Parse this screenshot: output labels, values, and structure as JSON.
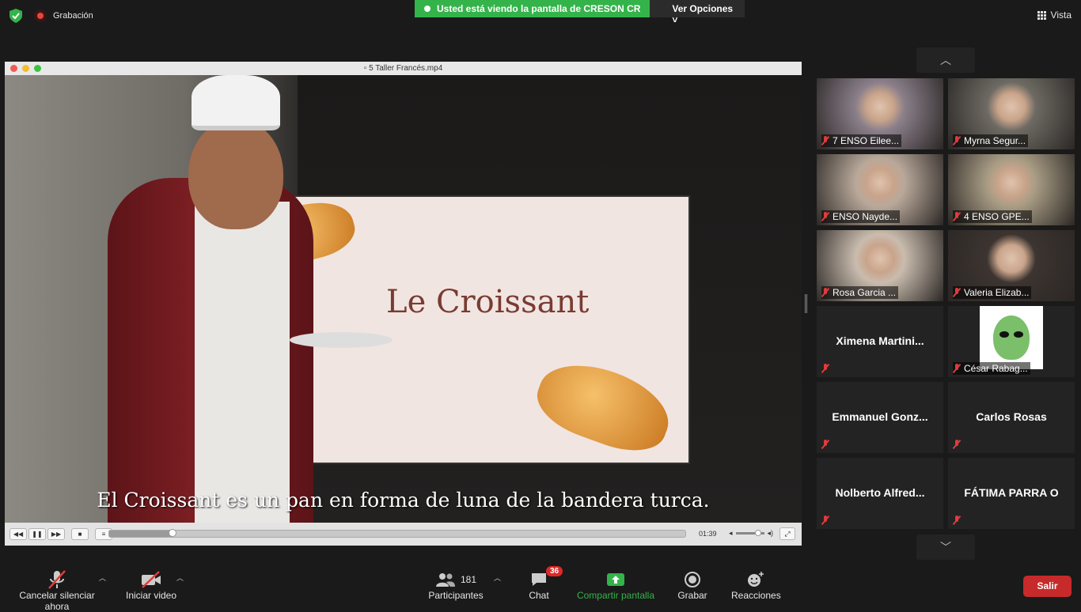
{
  "topbar": {
    "recording_label": "Grabación",
    "viewing_banner": "Usted está viendo la pantalla de CRESON CR",
    "view_options": "Ver Opciones",
    "view_button": "Vista",
    "shield_color": "#34b34a"
  },
  "player": {
    "filename": "5 Taller Francés.mp4",
    "screen_title": "Le Croissant",
    "subtitle": "El Croissant es un pan en forma de luna de la bandera turca.",
    "time": "01:39",
    "progress_fraction": 0.11,
    "buttons": {
      "rewind": "◀◀",
      "pause": "❚❚",
      "forward": "▶▶",
      "stop": "■",
      "playlist": "≡",
      "fullscreen": "⤢"
    },
    "volume_icon": "speaker-icon"
  },
  "participants": [
    {
      "name": "7 ENSO Eilee...",
      "video": true,
      "color": "#8a7f8a"
    },
    {
      "name": "Myrna Segur...",
      "video": true,
      "color": "#6d6a63"
    },
    {
      "name": "ENSO Nayde...",
      "video": true,
      "color": "#b8a89a"
    },
    {
      "name": "4 ENSO GPE...",
      "video": true,
      "color": "#a89c84"
    },
    {
      "name": "Rosa Garcia ...",
      "video": true,
      "color": "#c9bcae"
    },
    {
      "name": "Valeria Elizab...",
      "video": true,
      "color": "#3c3430"
    },
    {
      "name": "Ximena  Martini...",
      "video": false
    },
    {
      "name": "César Rabag...",
      "video": true,
      "avatar": true
    },
    {
      "name": "Emmanuel  Gonz...",
      "video": false
    },
    {
      "name": "Carlos Rosas",
      "video": false
    },
    {
      "name": "Nolberto  Alfred...",
      "video": false
    },
    {
      "name": "FÁTIMA PARRA O",
      "video": false
    }
  ],
  "toolbar": {
    "unmute": "Cancelar silenciar ahora",
    "start_video": "Iniciar video",
    "participants_label": "Participantes",
    "participants_count": "181",
    "chat_label": "Chat",
    "chat_badge": "36",
    "share_label": "Compartir pantalla",
    "record_label": "Grabar",
    "reactions_label": "Reacciones",
    "leave_label": "Salir",
    "share_color": "#34b34a",
    "leave_color": "#c72a2a"
  }
}
